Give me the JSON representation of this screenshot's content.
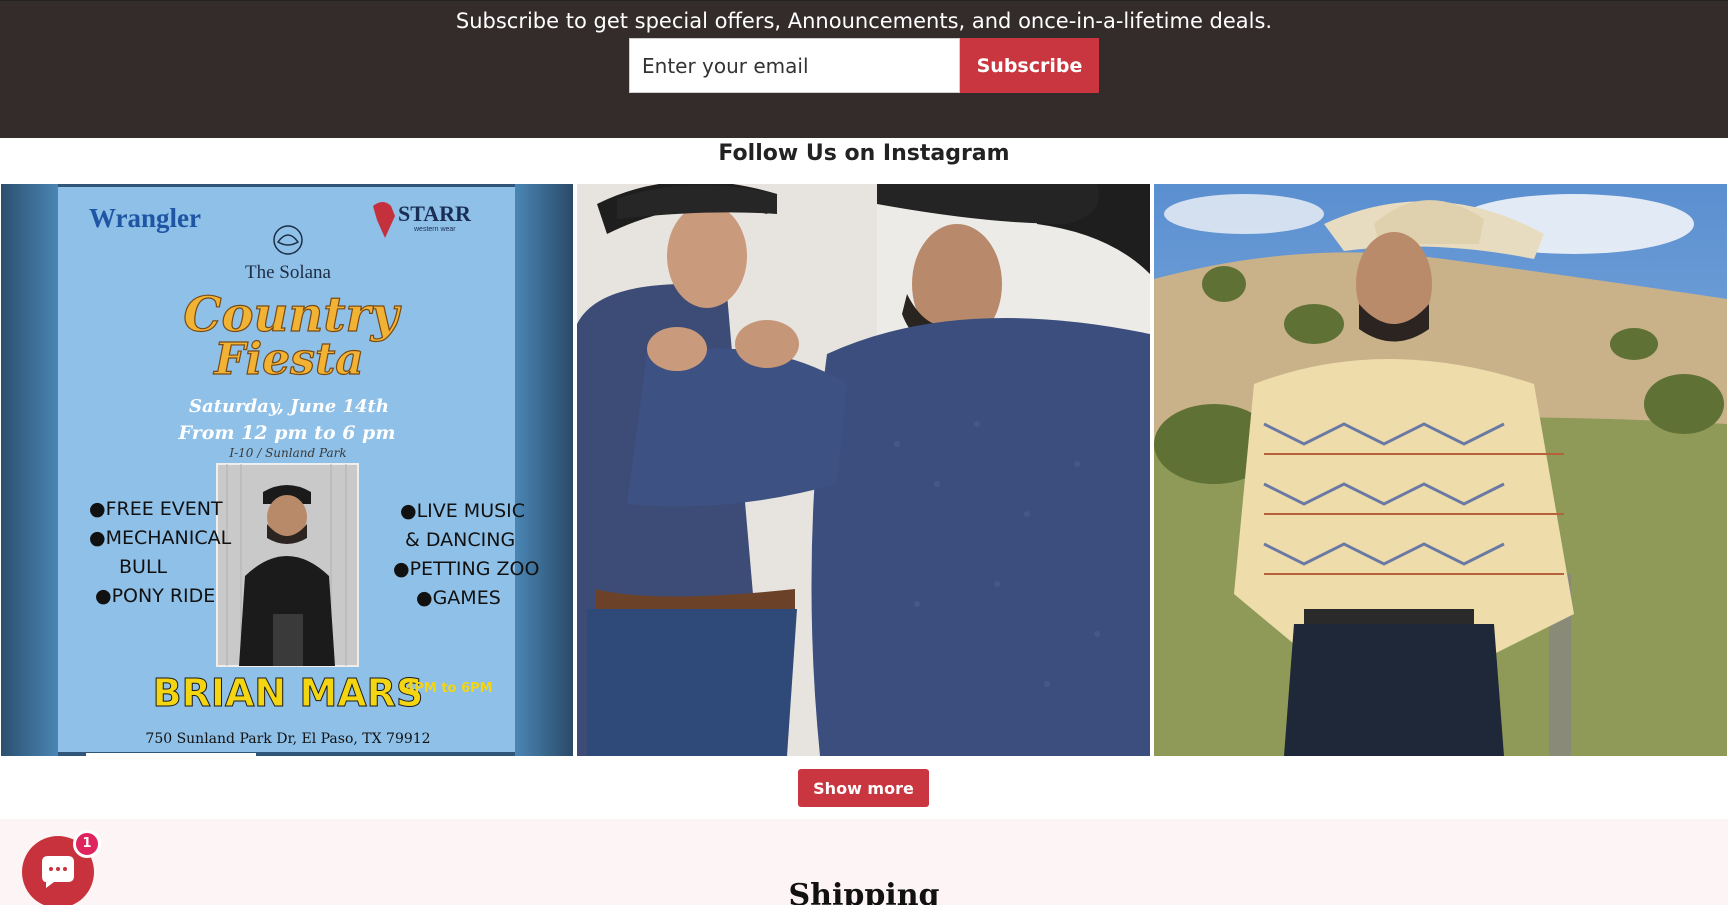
{
  "newsletter": {
    "text": "Subscribe to get special offers, Announcements, and once-in-a-lifetime deals.",
    "email_placeholder": "Enter your email",
    "subscribe_label": "Subscribe"
  },
  "instagram": {
    "heading": "Follow Us on Instagram",
    "show_more_label": "Show more",
    "poster": {
      "brand_left": "Wrangler",
      "brand_right": "STARR",
      "brand_right_sub": "western wear",
      "venue": "The Solana",
      "title_line1": "Country",
      "title_line2": "Fiesta",
      "date": "Saturday, June 14th",
      "time": "From 12 pm to 6 pm",
      "location": "I-10 / Sunland Park",
      "left_items": [
        "●FREE EVENT",
        "●MECHANICAL",
        "BULL",
        "●PONY RIDE"
      ],
      "right_items": [
        "●LIVE MUSIC",
        "& DANCING",
        "●PETTING ZOO",
        "●GAMES"
      ],
      "performer": "BRIAN MARS",
      "performer_time": "4PM to 6PM",
      "address": "750 Sunland Park Dr, El Paso, TX 79912"
    }
  },
  "shipping": {
    "heading": "Shipping"
  },
  "chat": {
    "icon": "chat-bubble-icon",
    "badge_count": "1"
  }
}
